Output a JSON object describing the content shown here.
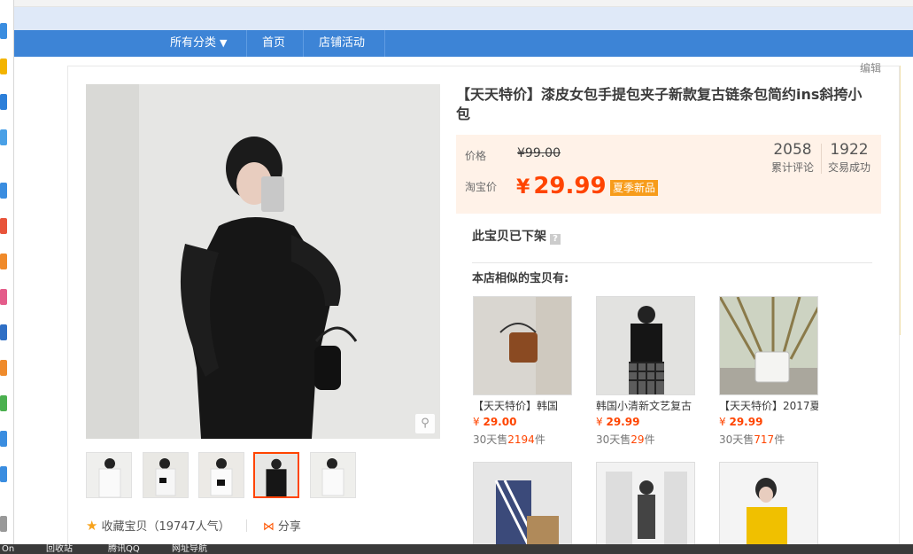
{
  "nav": {
    "category_label": "所有分类",
    "home_label": "首页",
    "activity_label": "店铺活动"
  },
  "edit_label": "编辑",
  "product": {
    "title": "【天天特价】漆皮女包手提包夹子新款复古链条包简约ins斜挎小包",
    "price_label": "价格",
    "original_price": "¥99.00",
    "taobao_price_label": "淘宝价",
    "currency": "¥",
    "current_price": "29.99",
    "badge": "夏季新品",
    "stats": [
      {
        "number": "2058",
        "label": "累计评论"
      },
      {
        "number": "1922",
        "label": "交易成功"
      }
    ],
    "status": "此宝贝已下架",
    "status_help": "?"
  },
  "actions": {
    "favorite": "收藏宝贝（19747人气）",
    "share": "分享"
  },
  "similar": {
    "heading": "本店相似的宝贝有:",
    "items": [
      {
        "name": "【天天特价】韩国",
        "currency": "¥",
        "price": "29.00",
        "sold_prefix": "30天售",
        "sold": "2194",
        "sold_suffix": "件"
      },
      {
        "name": "韩国小清新文艺复古",
        "currency": "¥",
        "price": "29.99",
        "sold_prefix": "30天售",
        "sold": "29",
        "sold_suffix": "件"
      },
      {
        "name": "【天天特价】2017夏",
        "currency": "¥",
        "price": "29.99",
        "sold_prefix": "30天售",
        "sold": "717",
        "sold_suffix": "件"
      }
    ]
  },
  "taskbar": {
    "items": [
      "On",
      "回收站",
      "腾讯QQ",
      "网址导航"
    ]
  },
  "colors": {
    "nav_blue": "#3d84d6",
    "price_orange": "#ff4400",
    "price_box_bg": "#fff2e8",
    "badge_orange": "#f79c1b"
  },
  "icons": {
    "nav_caret": "chevron-down-icon",
    "favorite": "star-icon",
    "share": "share-icon",
    "zoom": "magnifier-icon",
    "help": "question-icon"
  }
}
